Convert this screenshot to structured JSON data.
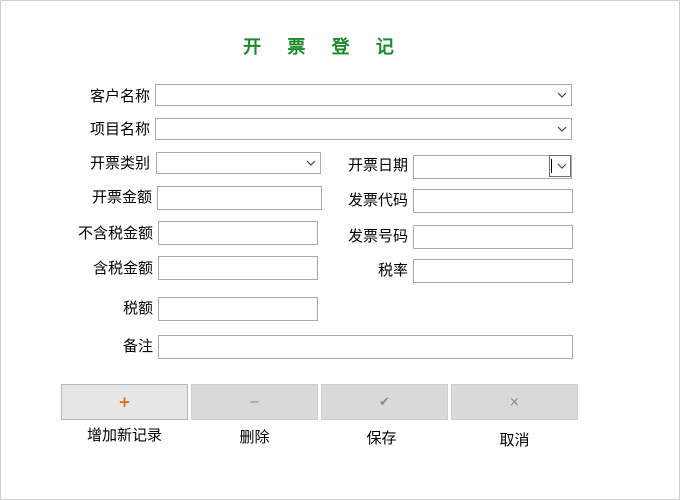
{
  "title": "开 票 登 记",
  "labels": {
    "customer": "客户名称",
    "project": "项目名称",
    "invoice_type": "开票类别",
    "invoice_date": "开票日期",
    "amount": "开票金额",
    "invoice_code": "发票代码",
    "amount_ex_tax": "不含税金额",
    "invoice_number": "发票号码",
    "amount_inc_tax": "含税金额",
    "tax_rate": "税率",
    "tax_amount": "税额",
    "remarks": "备注"
  },
  "fields": {
    "customer": "",
    "project": "",
    "invoice_type": "",
    "invoice_date": "",
    "amount": "",
    "invoice_code": "",
    "amount_ex_tax": "",
    "invoice_number": "",
    "amount_inc_tax": "",
    "tax_rate": "",
    "tax_amount": "",
    "remarks": ""
  },
  "buttons": {
    "add": {
      "glyph": "+",
      "label": "增加新记录"
    },
    "delete": {
      "glyph": "−",
      "label": "删除"
    },
    "save": {
      "glyph": "✔",
      "label": "保存"
    },
    "cancel": {
      "glyph": "×",
      "label": "取消"
    }
  },
  "icons": {
    "dropdown": "chevron-down-icon",
    "add": "plus-icon",
    "delete": "minus-icon",
    "save": "check-icon",
    "cancel": "close-icon"
  },
  "colors": {
    "title": "#1c8a2a",
    "add_glyph": "#e06a10",
    "button_bg": "#d9d9d9"
  }
}
